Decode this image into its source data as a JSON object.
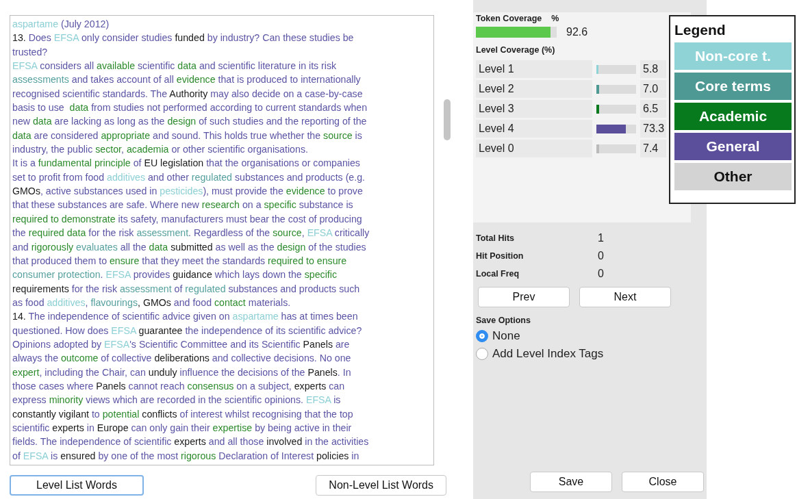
{
  "document": {
    "lines": [
      [
        {
          "text": "aspartame",
          "kind": "noncore"
        },
        {
          "text": " (July 2012)",
          "kind": "general"
        }
      ],
      [
        {
          "text": "13. ",
          "kind": "other"
        },
        {
          "text": "Does ",
          "kind": "general"
        },
        {
          "text": "EFSA",
          "kind": "noncore"
        },
        {
          "text": " only consider studies ",
          "kind": "general"
        },
        {
          "text": "funded",
          "kind": "other"
        },
        {
          "text": " by industry? Can these studies be",
          "kind": "general"
        }
      ],
      [
        {
          "text": "trusted?",
          "kind": "general"
        }
      ],
      [
        {
          "text": "EFSA",
          "kind": "noncore"
        },
        {
          "text": " considers all ",
          "kind": "general"
        },
        {
          "text": "available",
          "kind": "academic"
        },
        {
          "text": " scientific ",
          "kind": "general"
        },
        {
          "text": "data",
          "kind": "academic"
        },
        {
          "text": " and scientific literature in its risk",
          "kind": "general"
        }
      ],
      [
        {
          "text": "assessments",
          "kind": "core"
        },
        {
          "text": " and takes account of all ",
          "kind": "general"
        },
        {
          "text": "evidence",
          "kind": "academic"
        },
        {
          "text": " that is produced to internationally",
          "kind": "general"
        }
      ],
      [
        {
          "text": "recognised scientific standards. The ",
          "kind": "general"
        },
        {
          "text": "Authority",
          "kind": "other"
        },
        {
          "text": " may also decide on a case-by-case",
          "kind": "general"
        }
      ],
      [
        {
          "text": "basis to use  ",
          "kind": "general"
        },
        {
          "text": "data",
          "kind": "academic"
        },
        {
          "text": " from studies not performed according to current standards when",
          "kind": "general"
        }
      ],
      [
        {
          "text": "new ",
          "kind": "general"
        },
        {
          "text": "data",
          "kind": "academic"
        },
        {
          "text": " are lacking as long as the ",
          "kind": "general"
        },
        {
          "text": "design",
          "kind": "academic"
        },
        {
          "text": " of such studies and the reporting of the",
          "kind": "general"
        }
      ],
      [
        {
          "text": "data",
          "kind": "academic"
        },
        {
          "text": " are considered ",
          "kind": "general"
        },
        {
          "text": "appropriate",
          "kind": "academic"
        },
        {
          "text": " and sound. This holds true whether the ",
          "kind": "general"
        },
        {
          "text": "source",
          "kind": "academic"
        },
        {
          "text": " is",
          "kind": "general"
        }
      ],
      [
        {
          "text": "industry, the public ",
          "kind": "general"
        },
        {
          "text": "sector",
          "kind": "academic"
        },
        {
          "text": ", ",
          "kind": "general"
        },
        {
          "text": "academia",
          "kind": "academic"
        },
        {
          "text": " or other scientific organisations.",
          "kind": "general"
        }
      ],
      [
        {
          "text": "It is a ",
          "kind": "general"
        },
        {
          "text": "fundamental principle",
          "kind": "academic"
        },
        {
          "text": " of ",
          "kind": "general"
        },
        {
          "text": "EU legislation",
          "kind": "other"
        },
        {
          "text": " that the organisations or companies",
          "kind": "general"
        }
      ],
      [
        {
          "text": "set to profit from food ",
          "kind": "general"
        },
        {
          "text": "additives",
          "kind": "noncore"
        },
        {
          "text": " and other ",
          "kind": "general"
        },
        {
          "text": "regulated",
          "kind": "core"
        },
        {
          "text": " substances and products (e.g.",
          "kind": "general"
        }
      ],
      [
        {
          "text": "GMOs",
          "kind": "other"
        },
        {
          "text": ", active substances used in ",
          "kind": "general"
        },
        {
          "text": "pesticides",
          "kind": "noncore"
        },
        {
          "text": "), must provide the ",
          "kind": "general"
        },
        {
          "text": "evidence",
          "kind": "academic"
        },
        {
          "text": " to prove",
          "kind": "general"
        }
      ],
      [
        {
          "text": "that these substances are safe. Where new ",
          "kind": "general"
        },
        {
          "text": "research",
          "kind": "academic"
        },
        {
          "text": " on a ",
          "kind": "general"
        },
        {
          "text": "specific",
          "kind": "academic"
        },
        {
          "text": " substance is",
          "kind": "general"
        }
      ],
      [
        {
          "text": "required to demonstrate",
          "kind": "academic"
        },
        {
          "text": " its safety, manufacturers must bear the cost of producing",
          "kind": "general"
        }
      ],
      [
        {
          "text": "the ",
          "kind": "general"
        },
        {
          "text": "required data",
          "kind": "academic"
        },
        {
          "text": " for the risk ",
          "kind": "general"
        },
        {
          "text": "assessment",
          "kind": "core"
        },
        {
          "text": ". Regardless of the ",
          "kind": "general"
        },
        {
          "text": "source",
          "kind": "academic"
        },
        {
          "text": ", ",
          "kind": "general"
        },
        {
          "text": "EFSA",
          "kind": "noncore"
        },
        {
          "text": " critically",
          "kind": "general"
        }
      ],
      [
        {
          "text": "and ",
          "kind": "general"
        },
        {
          "text": "rigorously",
          "kind": "academic"
        },
        {
          "text": " evaluates",
          "kind": "core"
        },
        {
          "text": " all the ",
          "kind": "general"
        },
        {
          "text": "data",
          "kind": "academic"
        },
        {
          "text": " submitted",
          "kind": "other"
        },
        {
          "text": " as well as the ",
          "kind": "general"
        },
        {
          "text": "design",
          "kind": "academic"
        },
        {
          "text": " of the studies",
          "kind": "general"
        }
      ],
      [
        {
          "text": "that produced them to ",
          "kind": "general"
        },
        {
          "text": "ensure",
          "kind": "academic"
        },
        {
          "text": " that they meet the standards ",
          "kind": "general"
        },
        {
          "text": "required to ensure",
          "kind": "academic"
        }
      ],
      [
        {
          "text": "consumer protection",
          "kind": "core"
        },
        {
          "text": ". ",
          "kind": "general"
        },
        {
          "text": "EFSA",
          "kind": "noncore"
        },
        {
          "text": " provides ",
          "kind": "general"
        },
        {
          "text": "guidance",
          "kind": "other"
        },
        {
          "text": " which lays down the ",
          "kind": "general"
        },
        {
          "text": "specific",
          "kind": "academic"
        }
      ],
      [
        {
          "text": "requirements",
          "kind": "other"
        },
        {
          "text": " for the risk ",
          "kind": "general"
        },
        {
          "text": "assessment",
          "kind": "core"
        },
        {
          "text": " of ",
          "kind": "general"
        },
        {
          "text": "regulated",
          "kind": "core"
        },
        {
          "text": " substances and products such",
          "kind": "general"
        }
      ],
      [
        {
          "text": "as food ",
          "kind": "general"
        },
        {
          "text": "additives",
          "kind": "noncore"
        },
        {
          "text": ", ",
          "kind": "general"
        },
        {
          "text": "flavourings",
          "kind": "core"
        },
        {
          "text": ", GMOs",
          "kind": "other"
        },
        {
          "text": " and food ",
          "kind": "general"
        },
        {
          "text": "contact",
          "kind": "academic"
        },
        {
          "text": " materials.",
          "kind": "general"
        }
      ],
      [
        {
          "text": "14.",
          "kind": "other"
        },
        {
          "text": " The independence of scientific advice given on ",
          "kind": "general"
        },
        {
          "text": "aspartame",
          "kind": "noncore"
        },
        {
          "text": " has at times been",
          "kind": "general"
        }
      ],
      [
        {
          "text": "questioned. How does ",
          "kind": "general"
        },
        {
          "text": "EFSA",
          "kind": "noncore"
        },
        {
          "text": " guarantee",
          "kind": "other"
        },
        {
          "text": " the independence of its scientific advice?",
          "kind": "general"
        }
      ],
      [
        {
          "text": "Opinions adopted by ",
          "kind": "general"
        },
        {
          "text": "EFSA",
          "kind": "noncore"
        },
        {
          "text": "'s Scientific Committee and its Scientific ",
          "kind": "general"
        },
        {
          "text": "Panels",
          "kind": "other"
        },
        {
          "text": " are",
          "kind": "general"
        }
      ],
      [
        {
          "text": "always the ",
          "kind": "general"
        },
        {
          "text": "outcome",
          "kind": "academic"
        },
        {
          "text": " of collective ",
          "kind": "general"
        },
        {
          "text": "deliberations",
          "kind": "other"
        },
        {
          "text": " and collective decisions. No one",
          "kind": "general"
        }
      ],
      [
        {
          "text": "expert",
          "kind": "academic"
        },
        {
          "text": ", including the Chair, can ",
          "kind": "general"
        },
        {
          "text": "unduly",
          "kind": "other"
        },
        {
          "text": " influence the decisions of the ",
          "kind": "general"
        },
        {
          "text": "Panels",
          "kind": "other"
        },
        {
          "text": ". In",
          "kind": "general"
        }
      ],
      [
        {
          "text": "those cases where ",
          "kind": "general"
        },
        {
          "text": "Panels",
          "kind": "other"
        },
        {
          "text": " cannot reach ",
          "kind": "general"
        },
        {
          "text": "consensus",
          "kind": "academic"
        },
        {
          "text": " on a subject, ",
          "kind": "general"
        },
        {
          "text": "experts",
          "kind": "other"
        },
        {
          "text": " can",
          "kind": "general"
        }
      ],
      [
        {
          "text": "express ",
          "kind": "general"
        },
        {
          "text": "minority",
          "kind": "academic"
        },
        {
          "text": " views which are recorded in the scientific opinions. ",
          "kind": "general"
        },
        {
          "text": "EFSA",
          "kind": "noncore"
        },
        {
          "text": " is",
          "kind": "general"
        }
      ],
      [
        {
          "text": "constantly vigilant",
          "kind": "other"
        },
        {
          "text": " to ",
          "kind": "general"
        },
        {
          "text": "potential",
          "kind": "academic"
        },
        {
          "text": " conflicts",
          "kind": "other"
        },
        {
          "text": " of interest whilst recognising that the top",
          "kind": "general"
        }
      ],
      [
        {
          "text": "scientific ",
          "kind": "general"
        },
        {
          "text": "experts",
          "kind": "other"
        },
        {
          "text": " in ",
          "kind": "general"
        },
        {
          "text": "Europe",
          "kind": "other"
        },
        {
          "text": " can only gain their ",
          "kind": "general"
        },
        {
          "text": "expertise",
          "kind": "academic"
        },
        {
          "text": " by being active in their",
          "kind": "general"
        }
      ],
      [
        {
          "text": "fields. The independence of scientific ",
          "kind": "general"
        },
        {
          "text": "experts",
          "kind": "other"
        },
        {
          "text": " and all those ",
          "kind": "general"
        },
        {
          "text": "involved",
          "kind": "other"
        },
        {
          "text": " in the activities",
          "kind": "general"
        }
      ],
      [
        {
          "text": "of ",
          "kind": "general"
        },
        {
          "text": "EFSA",
          "kind": "noncore"
        },
        {
          "text": " is ",
          "kind": "general"
        },
        {
          "text": "ensured",
          "kind": "other"
        },
        {
          "text": " by one of the most ",
          "kind": "general"
        },
        {
          "text": "rigorous",
          "kind": "academic"
        },
        {
          "text": " Declaration of Interest ",
          "kind": "general"
        },
        {
          "text": "policies",
          "kind": "other"
        },
        {
          "text": " in",
          "kind": "general"
        }
      ]
    ]
  },
  "list_buttons": [
    {
      "label": "Level List Words",
      "focused": true
    },
    {
      "label": "Non-Level List Words",
      "focused": false
    }
  ],
  "token_coverage": {
    "label": "Token Coverage",
    "unit": "%",
    "level": 0.926,
    "reading": "92.6"
  },
  "level_coverage": {
    "title": "Level Coverage (%)",
    "rows": [
      {
        "name": "Level 1",
        "kind": "noncore",
        "level": 0.058,
        "reading": "5.8"
      },
      {
        "name": "Level 2",
        "kind": "core",
        "level": 0.07,
        "reading": "7.0"
      },
      {
        "name": "Level 3",
        "kind": "academic",
        "level": 0.065,
        "reading": "6.5"
      },
      {
        "name": "Level 4",
        "kind": "general",
        "level": 0.733,
        "reading": "73.3"
      },
      {
        "name": "Level 0",
        "kind": "other",
        "level": 0.074,
        "reading": "7.4"
      }
    ]
  },
  "stats": [
    {
      "label": "Total Hits",
      "value": "1"
    },
    {
      "label": "Hit Position",
      "value": "0"
    },
    {
      "label": "Local Freq",
      "value": "0"
    }
  ],
  "nav_buttons": [
    "Prev",
    "Next"
  ],
  "save_options": {
    "title": "Save Options",
    "options": [
      {
        "label": "None",
        "selected": true
      },
      {
        "label": "Add Level Index Tags",
        "selected": false
      }
    ]
  },
  "action_buttons": [
    "Save",
    "Close"
  ],
  "legend": {
    "title": "Legend",
    "items": [
      {
        "label": "Non-core t.",
        "kind": "noncore",
        "color": "#8fd3d6"
      },
      {
        "label": "Core terms",
        "kind": "core",
        "color": "#4f9995"
      },
      {
        "label": "Academic",
        "kind": "academic",
        "color": "#087a1e"
      },
      {
        "label": "General",
        "kind": "general",
        "color": "#5b4f9c"
      },
      {
        "label": "Other",
        "kind": "other",
        "color": "#d3d3d3"
      }
    ]
  }
}
